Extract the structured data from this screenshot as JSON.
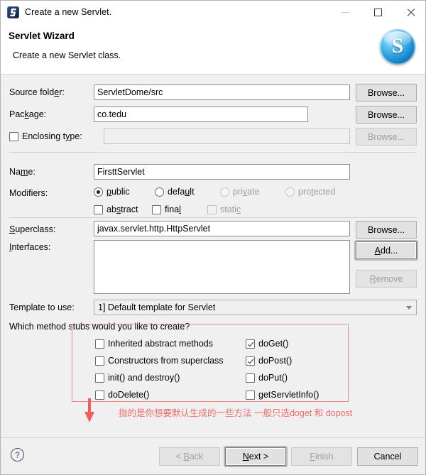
{
  "window": {
    "title": "Create a new Servlet.",
    "icon": "servlet-app-icon",
    "controls": {
      "minimize": "minimize-icon",
      "maximize": "maximize-icon",
      "close": "close-icon"
    }
  },
  "header": {
    "title": "Servlet Wizard",
    "subtitle": "Create a new Servlet class.",
    "logo_letter": "S"
  },
  "fields": {
    "source_folder": {
      "label": "Source folder:",
      "value": "ServletDome/src",
      "browse": "Browse..."
    },
    "package": {
      "label": "Package:",
      "value": "co.tedu",
      "browse": "Browse..."
    },
    "enclosing_type": {
      "label": "Enclosing type:",
      "value": "",
      "checked": false,
      "browse": "Browse...",
      "enabled": false
    },
    "name": {
      "label": "Name:",
      "value": "FirsttServlet"
    },
    "modifiers": {
      "label": "Modifiers:",
      "radios": [
        {
          "label": "public",
          "checked": true,
          "enabled": true
        },
        {
          "label": "default",
          "checked": false,
          "enabled": true
        },
        {
          "label": "private",
          "checked": false,
          "enabled": false
        },
        {
          "label": "protected",
          "checked": false,
          "enabled": false
        }
      ],
      "checks": [
        {
          "label": "abstract",
          "checked": false,
          "enabled": true
        },
        {
          "label": "final",
          "checked": false,
          "enabled": true
        },
        {
          "label": "static",
          "checked": false,
          "enabled": false
        }
      ]
    },
    "superclass": {
      "label": "Superclass:",
      "value": "javax.servlet.http.HttpServlet",
      "browse": "Browse..."
    },
    "interfaces": {
      "label": "Interfaces:",
      "items": [],
      "add": "Add...",
      "remove": "Remove"
    },
    "template": {
      "label": "Template to use:",
      "value": "1] Default template for Servlet"
    }
  },
  "stubs": {
    "question": "Which method stubs would you like to create?",
    "left": [
      {
        "label": "Inherited abstract methods",
        "checked": false
      },
      {
        "label": "Constructors from superclass",
        "checked": false
      },
      {
        "label": "init() and destroy()",
        "checked": false
      },
      {
        "label": "doDelete()",
        "checked": false
      }
    ],
    "right": [
      {
        "label": "doGet()",
        "checked": true
      },
      {
        "label": "doPost()",
        "checked": true
      },
      {
        "label": "doPut()",
        "checked": false
      },
      {
        "label": "getServletInfo()",
        "checked": false
      }
    ]
  },
  "annotation": {
    "text": "指的是你想要默认生成的一些方法 一般只选doget 和 dopost",
    "color": "#f06a6a"
  },
  "footer": {
    "help": "?",
    "buttons": [
      {
        "label": "< Back",
        "enabled": false,
        "focused": false
      },
      {
        "label": "Next >",
        "enabled": true,
        "focused": true
      },
      {
        "label": "Finish",
        "enabled": false,
        "focused": false
      },
      {
        "label": "Cancel",
        "enabled": true,
        "focused": false
      }
    ]
  }
}
